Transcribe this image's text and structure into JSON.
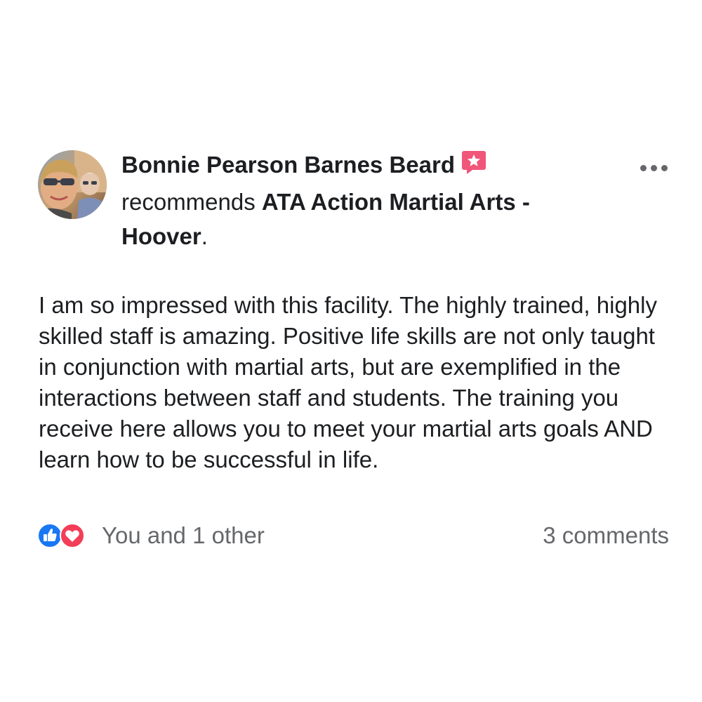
{
  "post": {
    "author": "Bonnie Pearson Barnes Beard",
    "action": "recommends",
    "page": "ATA Action Martial Arts - Hoover",
    "page_suffix": ".",
    "body": "I am so impressed with this facility. The highly trained, highly skilled staff is amazing. Positive life skills are not only taught in conjunction with martial arts, but are exemplified in the interactions between staff and students. The training you receive here allows you to meet your martial arts goals AND learn how to be successful in life.",
    "reactions": {
      "types": [
        "like",
        "love"
      ],
      "summary": "You and 1 other"
    },
    "comments": "3 comments"
  },
  "icons": {
    "recommendation_badge": "recommendation-star-icon",
    "more": "more-horizontal-icon",
    "like": "like-reaction-icon",
    "love": "love-reaction-icon"
  },
  "colors": {
    "recommendation_badge": "#f0557a",
    "like": "#1877f2",
    "love": "#f33e58",
    "secondary_text": "#65676b",
    "primary_text": "#1c1e21"
  }
}
